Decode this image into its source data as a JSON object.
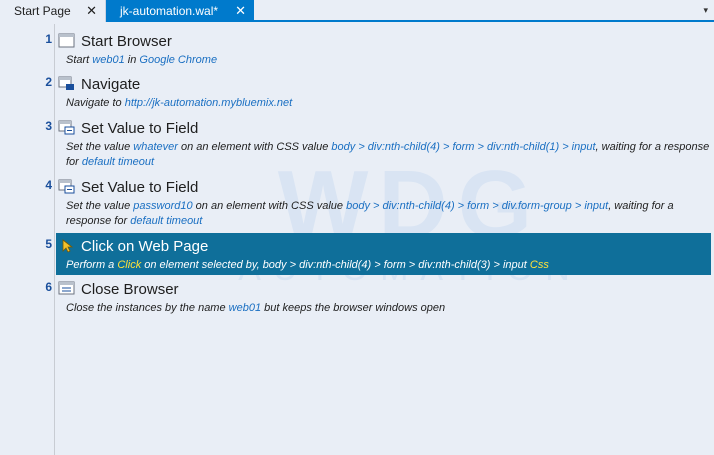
{
  "tabs": [
    {
      "label": "Start Page",
      "close": "✕"
    },
    {
      "label": "jk-automation.wal*",
      "close": "✕"
    }
  ],
  "tab_dropdown": "▾",
  "watermark": {
    "big": "WDG",
    "small": "AUTOMATION"
  },
  "steps": [
    {
      "num": "1",
      "icon": "window-icon",
      "title": "Start Browser",
      "desc": [
        {
          "t": "Start "
        },
        {
          "t": "web01",
          "link": true
        },
        {
          "t": " in "
        },
        {
          "t": "Google Chrome",
          "link": true
        }
      ]
    },
    {
      "num": "2",
      "icon": "navigate-icon",
      "title": "Navigate",
      "desc": [
        {
          "t": "Navigate to "
        },
        {
          "t": "http://jk-automation.mybluemix.net",
          "link": true
        }
      ]
    },
    {
      "num": "3",
      "icon": "set-field-icon",
      "title": "Set Value to Field",
      "desc": [
        {
          "t": "Set the value "
        },
        {
          "t": "whatever",
          "link": true
        },
        {
          "t": " on an element with CSS value "
        },
        {
          "t": "body > div:nth-child(4) > form > div:nth-child(1) > input",
          "link": true
        },
        {
          "t": ", waiting for a response for "
        },
        {
          "t": "default timeout",
          "link": true
        }
      ]
    },
    {
      "num": "4",
      "icon": "set-field-icon",
      "title": "Set Value to Field",
      "desc": [
        {
          "t": "Set the value "
        },
        {
          "t": "password10",
          "link": true
        },
        {
          "t": " on an element with CSS value "
        },
        {
          "t": "body > div:nth-child(4) > form > div.form-group > input",
          "link": true
        },
        {
          "t": ", waiting for a response for "
        },
        {
          "t": "default timeout",
          "link": true
        }
      ]
    },
    {
      "num": "5",
      "icon": "cursor-icon",
      "title": "Click on Web Page",
      "selected": true,
      "desc": [
        {
          "t": "Perform a "
        },
        {
          "t": "Click",
          "hl": true
        },
        {
          "t": " on element selected by, "
        },
        {
          "t": "body > div:nth-child(4) > form > div:nth-child(3) > input",
          "link": true
        },
        {
          "t": " "
        },
        {
          "t": "Css",
          "hl": true
        }
      ]
    },
    {
      "num": "6",
      "icon": "close-browser-icon",
      "title": "Close Browser",
      "desc": [
        {
          "t": "Close the instances by the name "
        },
        {
          "t": "web01",
          "link": true
        },
        {
          "t": " but keeps the browser windows open"
        }
      ]
    }
  ]
}
